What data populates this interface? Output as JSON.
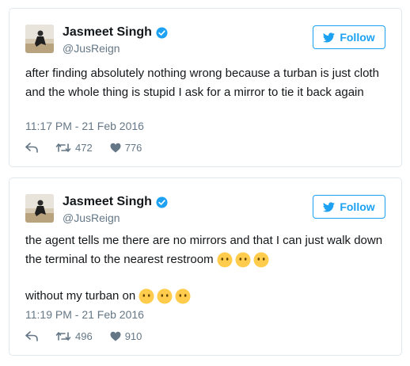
{
  "tweets": [
    {
      "author": {
        "name": "Jasmeet Singh",
        "handle": "@JusReign",
        "verified": true
      },
      "follow_label": "Follow",
      "text_lines": [
        "after finding absolutely nothing wrong because a turban is just cloth and the whole thing is stupid I ask for a mirror to tie it back again"
      ],
      "timestamp": "11:17 PM - 21 Feb 2016",
      "retweets": "472",
      "likes": "776"
    },
    {
      "author": {
        "name": "Jasmeet Singh",
        "handle": "@JusReign",
        "verified": true
      },
      "follow_label": "Follow",
      "text_lines": [
        "the agent tells me there are no mirrors and that I can just walk down the terminal to the nearest restroom",
        "without my turban on"
      ],
      "emoji_after_each_line": "no-mouth-face x3",
      "timestamp": "11:19 PM - 21 Feb 2016",
      "retweets": "496",
      "likes": "910"
    }
  ],
  "colors": {
    "accent": "#1da1f2",
    "muted": "#657786",
    "text": "#14171a",
    "border": "#e1e8ed"
  },
  "icons": [
    "verified-badge-icon",
    "twitter-bird-icon",
    "reply-icon",
    "retweet-icon",
    "heart-icon",
    "no-mouth-emoji-icon"
  ]
}
